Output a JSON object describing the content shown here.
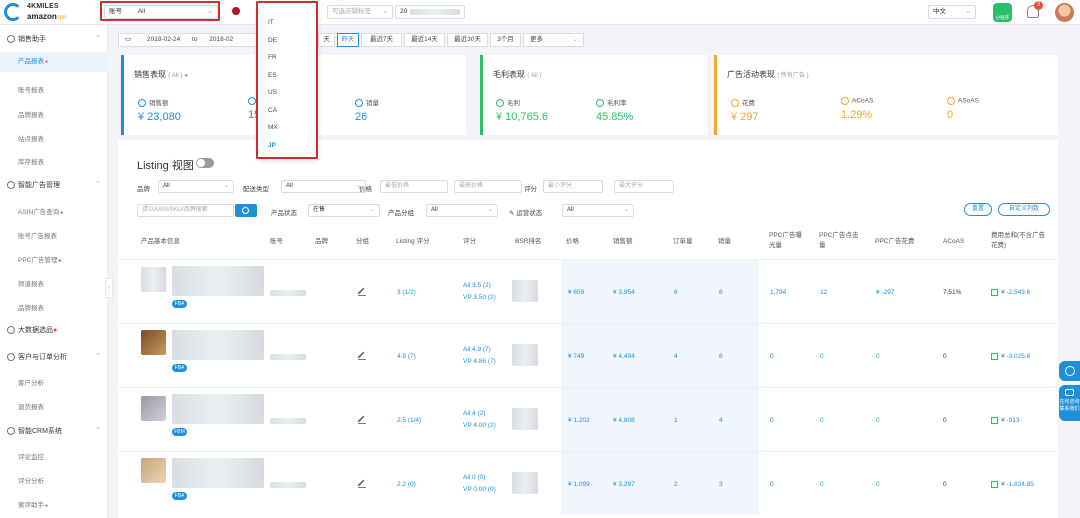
{
  "logo": {
    "line1": "4KMILES",
    "line2": "amazon",
    "line2_suffix": "spn"
  },
  "topbar": {
    "account_label": "账号",
    "account_value": "All",
    "market_selected": "JP",
    "tag_placeholder": "可选店铺标签",
    "date_prefix": "20",
    "language": "中文",
    "mini_program": "小程序",
    "notification_count": "3"
  },
  "market_dropdown": {
    "options": [
      "IT",
      "DE",
      "FR",
      "ES",
      "US",
      "CA",
      "MX",
      "JP"
    ],
    "selected": "JP"
  },
  "sidebar": {
    "groups": [
      {
        "label": "销售助手"
      },
      {
        "label": "智能广告管理"
      },
      {
        "label": "大数据选品"
      },
      {
        "label": "客户与订单分析"
      },
      {
        "label": "智能CRM系统"
      }
    ],
    "sales_items": [
      "产品报表",
      "账号报表",
      "品牌报表",
      "站点报表",
      "库存报表"
    ],
    "ad_items": [
      "ASIN广告查询",
      "账号广告报表",
      "PPC广告管理",
      "频道报表",
      "品牌报表"
    ],
    "customer_items": [
      "客户分析",
      "退货报表"
    ],
    "crm_items": [
      "评论监控",
      "评分分析",
      "索评助手"
    ]
  },
  "datebar": {
    "start": "2018-02-24",
    "to": "to",
    "end": "2018-02",
    "buttons": [
      "天",
      "昨天",
      "最近7天",
      "最近14天",
      "最近30天",
      "3个月",
      "更多"
    ]
  },
  "cards": {
    "sales": {
      "title": "销售表现",
      "sub": "( All )",
      "m1_label": "销售额",
      "m1_value": "¥ 23,080",
      "m2_value": "15",
      "m3_label": "销量",
      "m3_value": "26"
    },
    "profit": {
      "title": "毛利表现",
      "sub": "( All )",
      "m1_label": "毛利",
      "m1_value": "¥ 10,765.6",
      "m2_label": "毛利率",
      "m2_value": "45.85%"
    },
    "ads": {
      "title": "广告活动表现",
      "sub": "( 所有广告 )",
      "m1_label": "花费",
      "m1_value": "¥ 297",
      "m2_label": "ACoAS",
      "m2_value": "1.29%",
      "m3_label": "ASoAS",
      "m3_value": "0"
    }
  },
  "listing": {
    "title": "Listing 视图",
    "filters": {
      "brand_label": "品牌",
      "brand_value": "All",
      "ship_label": "配送类型",
      "ship_value": "All",
      "price_label": "价格",
      "price_min": "最低价格",
      "price_max": "最高价格",
      "rating_label": "评分",
      "rating_min": "最小评分",
      "rating_max": "最大评分",
      "search_placeholder": "请以ASIN/SKU/品牌搜索",
      "status_label": "产品状态",
      "status_value": "在售",
      "group_label": "产品分组",
      "group_value": "All",
      "ops_label": "运营状态",
      "ops_value": "All",
      "reset": "重置",
      "custom_cols": "自定义列数"
    },
    "headers": [
      "产品基本信息",
      "账号",
      "品牌",
      "分组",
      "Listing 评分",
      "评分",
      "BSR排名",
      "价格",
      "销售额",
      "订单量",
      "销量",
      "PPC广告曝光量",
      "PPC广告点击量",
      "PPC广告花费",
      "ACoAS",
      "费用总和(不含广告花费)"
    ],
    "rows": [
      {
        "listing_score": "3 (1/2)",
        "rating_all": "All 3.5 (2)",
        "rating_vp": "VP 3.50 (2)",
        "price": "¥ 659",
        "sales": "¥ 3,954",
        "orders": "6",
        "units": "6",
        "impressions": "1,794",
        "clicks": "12",
        "spend": "¥ -297",
        "acoas": "7.51%",
        "fees": "¥ -2,543.6",
        "tag": "FBA"
      },
      {
        "listing_score": "4.9 (7)",
        "rating_all": "All 4.9 (7)",
        "rating_vp": "VP 4.86 (7)",
        "price": "¥ 749",
        "sales": "¥ 4,494",
        "orders": "4",
        "units": "6",
        "impressions": "0",
        "clicks": "0",
        "spend": "0",
        "acoas": "0",
        "fees": "¥ -3,025.8",
        "tag": "FBA"
      },
      {
        "listing_score": "2.5 (1/4)",
        "rating_all": "All 4 (2)",
        "rating_vp": "VP 4.00 (2)",
        "price": "¥ 1,202",
        "sales": "¥ 4,808",
        "orders": "1",
        "units": "4",
        "impressions": "0",
        "clicks": "0",
        "spend": "0",
        "acoas": "0",
        "fees": "¥ -913",
        "tag": "FBM"
      },
      {
        "listing_score": "2.2 (0)",
        "rating_all": "All 0 (0)",
        "rating_vp": "VP 0.00 (0)",
        "price": "¥ 1,099",
        "sales": "¥ 3,297",
        "orders": "2",
        "units": "3",
        "impressions": "0",
        "clicks": "0",
        "spend": "0",
        "acoas": "0",
        "fees": "¥ -1,834.85",
        "tag": "FBA"
      }
    ]
  },
  "float": {
    "tab2": "在线咨询 联系我们"
  },
  "colors": {
    "accent": "#1e8fd8",
    "highlight_box": "#d22b2b",
    "green": "#2bbf6c",
    "orange": "#f5a623"
  }
}
